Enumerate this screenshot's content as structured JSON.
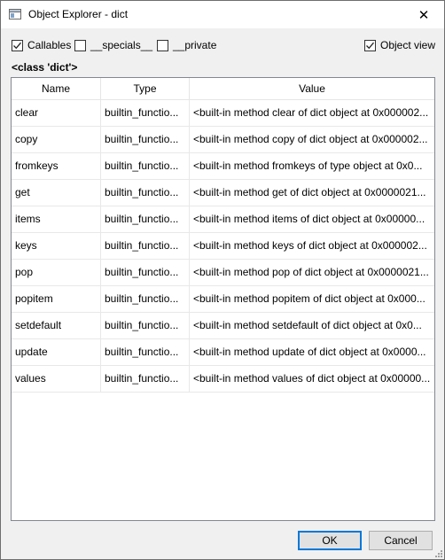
{
  "window": {
    "title": "Object Explorer - dict",
    "close_glyph": "✕"
  },
  "options": {
    "callables": {
      "label": "Callables",
      "checked": true
    },
    "specials": {
      "label": "__specials__",
      "checked": false
    },
    "private": {
      "label": "__private",
      "checked": false
    },
    "object_view": {
      "label": "Object view",
      "checked": true
    }
  },
  "class_label": "<class 'dict'>",
  "table": {
    "columns": [
      "Name",
      "Type",
      "Value"
    ],
    "rows": [
      {
        "name": "clear",
        "type": "builtin_functio...",
        "value": "<built-in method clear of dict object at 0x000002..."
      },
      {
        "name": "copy",
        "type": "builtin_functio...",
        "value": "<built-in method copy of dict object at 0x000002..."
      },
      {
        "name": "fromkeys",
        "type": "builtin_functio...",
        "value": "<built-in method fromkeys of type object at 0x0..."
      },
      {
        "name": "get",
        "type": "builtin_functio...",
        "value": "<built-in method get of dict object at 0x0000021..."
      },
      {
        "name": "items",
        "type": "builtin_functio...",
        "value": "<built-in method items of dict object at 0x00000..."
      },
      {
        "name": "keys",
        "type": "builtin_functio...",
        "value": "<built-in method keys of dict object at 0x000002..."
      },
      {
        "name": "pop",
        "type": "builtin_functio...",
        "value": "<built-in method pop of dict object at 0x0000021..."
      },
      {
        "name": "popitem",
        "type": "builtin_functio...",
        "value": "<built-in method popitem of dict object at 0x000..."
      },
      {
        "name": "setdefault",
        "type": "builtin_functio...",
        "value": "<built-in method setdefault of dict object at 0x0..."
      },
      {
        "name": "update",
        "type": "builtin_functio...",
        "value": "<built-in method update of dict object at 0x0000..."
      },
      {
        "name": "values",
        "type": "builtin_functio...",
        "value": "<built-in method values of dict object at 0x00000..."
      }
    ]
  },
  "buttons": {
    "ok": "OK",
    "cancel": "Cancel"
  }
}
